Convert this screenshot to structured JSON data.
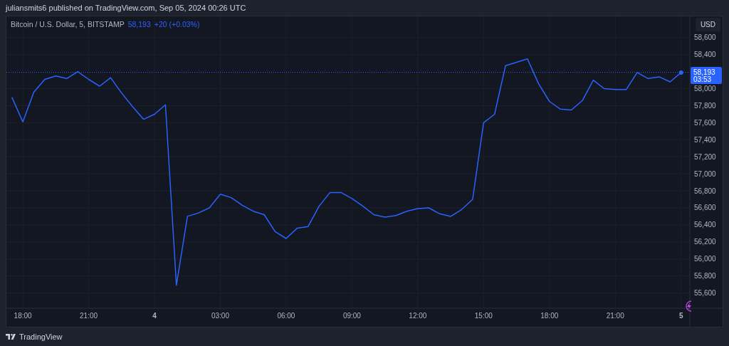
{
  "header": {
    "text": "juliansmits6 published on TradingView.com, Sep 05, 2024 00:26 UTC"
  },
  "chart": {
    "legend": {
      "symbol": "Bitcoin / U.S. Dollar, 5, BITSTAMP",
      "price": "58,193",
      "change": "+20 (+0.03%)"
    },
    "currency_button": "USD",
    "last_price": {
      "value": "58,193",
      "countdown": "03:53"
    },
    "chart_data": {
      "type": "line",
      "grid": true,
      "ref_lines": [
        {
          "axis": "y",
          "value": 58193,
          "color": "#2962ff"
        }
      ],
      "ylim": [
        55420,
        58850
      ],
      "categories": [
        null,
        "18:00",
        null,
        null,
        null,
        null,
        null,
        "21:00",
        null,
        null,
        null,
        null,
        null,
        "4",
        null,
        null,
        null,
        null,
        null,
        "03:00",
        null,
        null,
        null,
        null,
        null,
        "06:00",
        null,
        null,
        null,
        null,
        null,
        "09:00",
        null,
        null,
        null,
        null,
        null,
        "12:00",
        null,
        null,
        null,
        null,
        null,
        "15:00",
        null,
        null,
        null,
        null,
        null,
        "18:00",
        null,
        null,
        null,
        null,
        null,
        "21:00",
        null,
        null,
        null,
        null,
        null,
        "5"
      ],
      "series": [
        {
          "color": "#2962ff",
          "values": [
            57900,
            57610,
            57960,
            58110,
            58150,
            58120,
            58200,
            58110,
            58030,
            58130,
            57950,
            57790,
            57640,
            57700,
            57810,
            55690,
            56500,
            56540,
            56600,
            56760,
            56720,
            56630,
            56560,
            56520,
            56320,
            56240,
            56360,
            56380,
            56620,
            56780,
            56780,
            56710,
            56620,
            56520,
            56490,
            56510,
            56560,
            56590,
            56600,
            56530,
            56500,
            56580,
            56700,
            57600,
            57700,
            58270,
            58310,
            58350,
            58060,
            57850,
            57760,
            57750,
            57860,
            58100,
            58000,
            57990,
            57990,
            58190,
            58120,
            58140,
            58080,
            58190
          ]
        }
      ],
      "yticks": [
        {
          "value": 55600,
          "label": "55,600"
        },
        {
          "value": 55800,
          "label": "55,800"
        },
        {
          "value": 56000,
          "label": "56,000"
        },
        {
          "value": 56200,
          "label": "56,200"
        },
        {
          "value": 56400,
          "label": "56,400"
        },
        {
          "value": 56600,
          "label": "56,600"
        },
        {
          "value": 56800,
          "label": "56,800"
        },
        {
          "value": 57000,
          "label": "57,000"
        },
        {
          "value": 57200,
          "label": "57,200"
        },
        {
          "value": 57400,
          "label": "57,400"
        },
        {
          "value": 57600,
          "label": "57,600"
        },
        {
          "value": 57800,
          "label": "57,800"
        },
        {
          "value": 58000,
          "label": "58,000"
        },
        {
          "value": 58400,
          "label": "58,400"
        },
        {
          "value": 58600,
          "label": "58,600"
        }
      ]
    }
  },
  "footer": {
    "brand": "TradingView"
  }
}
